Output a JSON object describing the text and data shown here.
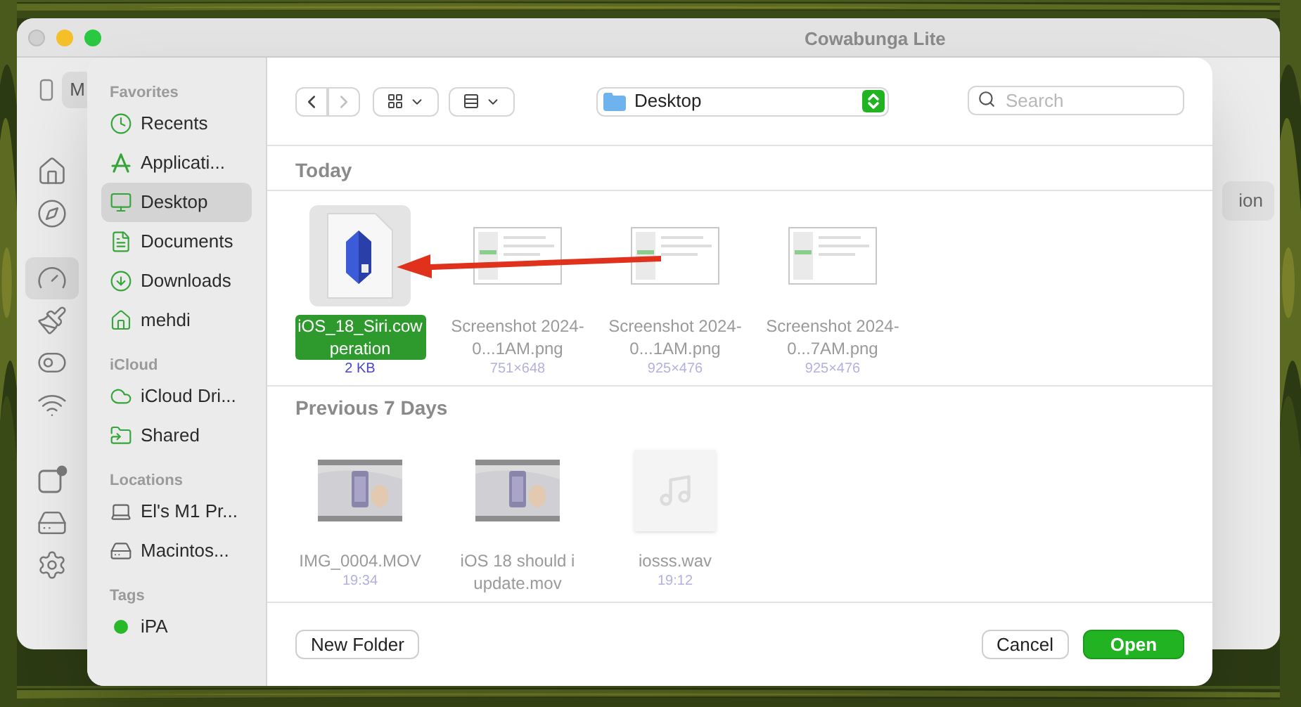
{
  "app_window": {
    "title": "Cowabunga Lite",
    "device_button": "M",
    "side_button": "ion",
    "nav": [
      {
        "kind": "home",
        "selected": false
      },
      {
        "kind": "compass",
        "selected": false
      },
      {
        "kind": "gauge",
        "selected": true
      },
      {
        "kind": "brush",
        "selected": false
      },
      {
        "kind": "toggles",
        "selected": false
      },
      {
        "kind": "wifi",
        "selected": false
      },
      {
        "kind": "badge",
        "selected": false
      },
      {
        "kind": "drive",
        "selected": false
      },
      {
        "kind": "gear",
        "selected": false
      }
    ]
  },
  "dialog": {
    "toolbar": {
      "back_disabled": false,
      "forward_disabled": true,
      "location": "Desktop",
      "search": {
        "placeholder": "Search"
      }
    },
    "sidebar": [
      {
        "heading": "Favorites",
        "items": [
          {
            "kind": "clock",
            "label": "Recents",
            "selected": false
          },
          {
            "kind": "apps",
            "label": "Applicati...",
            "selected": false
          },
          {
            "kind": "desktop",
            "label": "Desktop",
            "selected": true
          },
          {
            "kind": "document",
            "label": "Documents",
            "selected": false
          },
          {
            "kind": "download",
            "label": "Downloads",
            "selected": false
          },
          {
            "kind": "home",
            "label": "mehdi",
            "selected": false
          }
        ]
      },
      {
        "heading": "iCloud",
        "items": [
          {
            "kind": "cloud",
            "label": "iCloud Dri...",
            "selected": false
          },
          {
            "kind": "shared",
            "label": "Shared",
            "selected": false
          }
        ]
      },
      {
        "heading": "Locations",
        "items": [
          {
            "kind": "laptop",
            "label": "El's M1 Pr...",
            "selected": false
          },
          {
            "kind": "drive",
            "label": "Macintos...",
            "selected": false
          }
        ]
      },
      {
        "heading": "Tags",
        "items": [
          {
            "kind": "tag",
            "label": "iPA",
            "color": "#28b828",
            "selected": false
          }
        ]
      }
    ],
    "groups": [
      {
        "heading": "Today",
        "files": [
          {
            "kind": "cowp",
            "name": "iOS_18_Siri.cowperation",
            "detail": "2 KB",
            "selected": true,
            "disabled": false
          },
          {
            "kind": "screenshot",
            "name": "Screenshot 2024-0...1AM.png",
            "detail": "751×648",
            "selected": false,
            "disabled": true
          },
          {
            "kind": "screenshot",
            "name": "Screenshot 2024-0...1AM.png",
            "detail": "925×476",
            "selected": false,
            "disabled": true
          },
          {
            "kind": "screenshot",
            "name": "Screenshot 2024-0...7AM.png",
            "detail": "925×476",
            "selected": false,
            "disabled": true
          }
        ]
      },
      {
        "heading": "Previous 7 Days",
        "files": [
          {
            "kind": "video",
            "name": "IMG_0004.MOV",
            "detail": "19:34",
            "selected": false,
            "disabled": true
          },
          {
            "kind": "video",
            "name": "iOS 18 should i update.mov",
            "selected": false,
            "disabled": true
          },
          {
            "kind": "audio",
            "name": "iosss.wav",
            "detail": "19:12",
            "selected": false,
            "disabled": true
          }
        ]
      }
    ],
    "buttons": [
      {
        "kind": "secondary",
        "label": "New Folder"
      },
      {
        "kind": "secondary",
        "label": "Cancel"
      },
      {
        "kind": "primary",
        "label": "Open"
      }
    ]
  }
}
